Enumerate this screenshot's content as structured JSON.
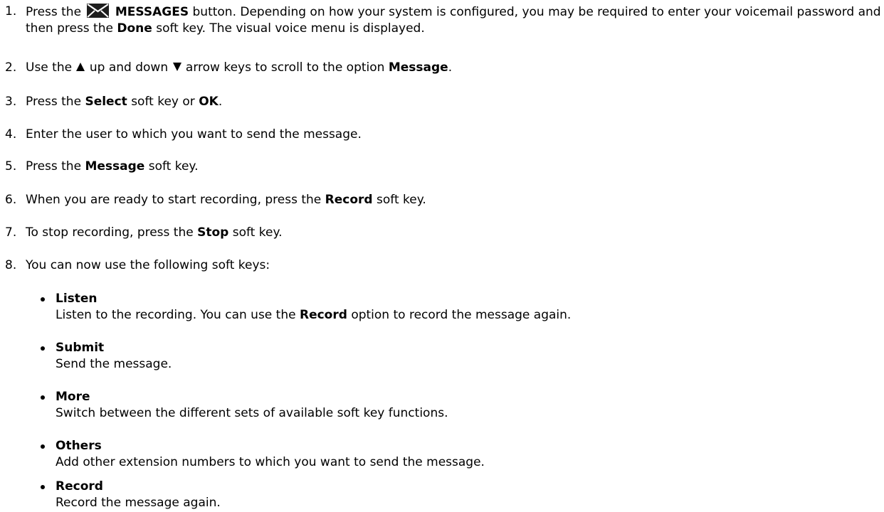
{
  "steps": [
    {
      "num": "1.",
      "t1": "Press the",
      "b1": "MESSAGES",
      "t2": "button. Depending on how your system is configured, you may be required to enter your voicemail password and then press the",
      "b2": "Done",
      "t3": "soft key. The visual voice menu is displayed."
    },
    {
      "num": "2.",
      "t1": "Use the",
      "t2": "up and down",
      "t3": "arrow keys to scroll to the option",
      "b1": "Message",
      "t4": "."
    },
    {
      "num": "3.",
      "t1": "Press the",
      "b1": "Select",
      "t2": "soft key or",
      "b2": "OK",
      "t3": "."
    },
    {
      "num": "4.",
      "t1": "Enter the user to which you want to send the message."
    },
    {
      "num": "5.",
      "t1": "Press the",
      "b1": "Message",
      "t2": "soft key."
    },
    {
      "num": "6.",
      "t1": "When you are ready to start recording, press the",
      "b1": "Record",
      "t2": "soft key."
    },
    {
      "num": "7.",
      "t1": "To stop recording, press the",
      "b1": "Stop",
      "t2": "soft key."
    },
    {
      "num": "8.",
      "t1": "You can now use the following soft keys:"
    }
  ],
  "soft_keys": [
    {
      "title": "Listen",
      "d1": "Listen to the recording. You can use the",
      "b1": "Record",
      "d2": "option to record the message again."
    },
    {
      "title": "Submit",
      "d1": "Send the message."
    },
    {
      "title": "More",
      "d1": "Switch between the different sets of available soft key functions."
    },
    {
      "title": "Others",
      "d1": "Add other extension numbers to which you want to send the message."
    },
    {
      "title": "Record",
      "d1": "Record the message again."
    }
  ],
  "icons": {
    "messages": "envelope-icon",
    "up": "up-arrow-icon",
    "down": "down-arrow-icon"
  }
}
